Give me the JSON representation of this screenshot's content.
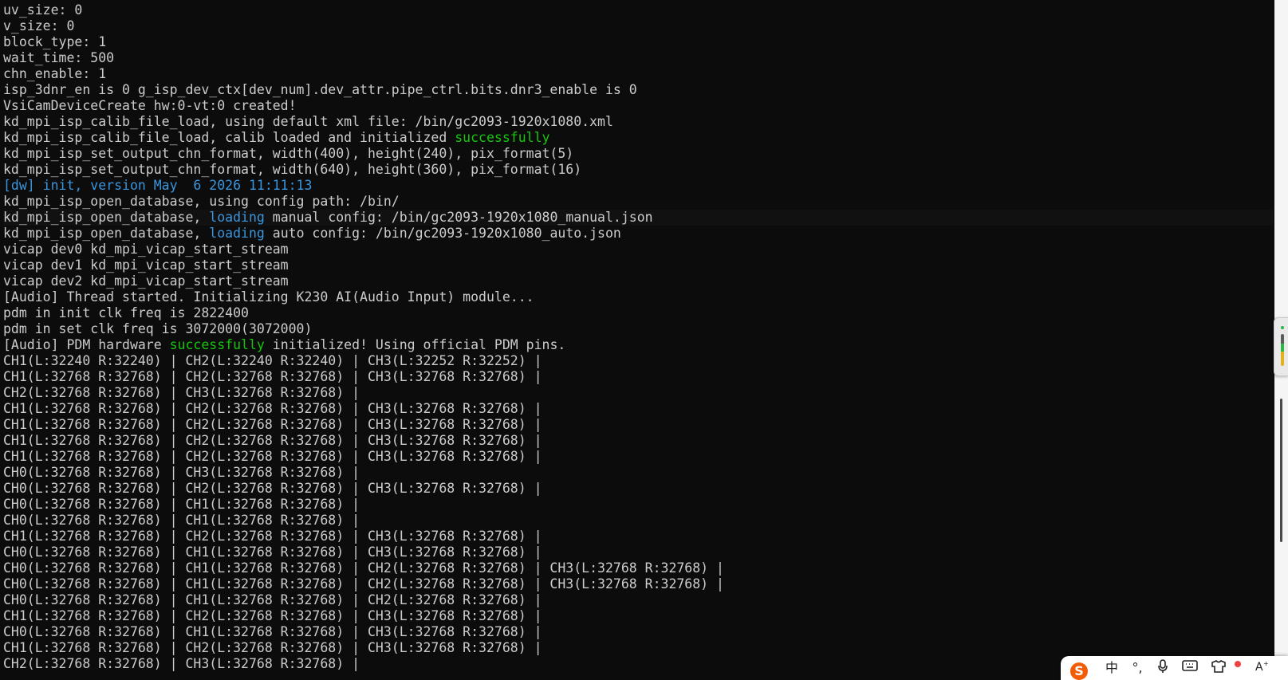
{
  "terminal": {
    "lines": [
      [
        {
          "t": "uv_size: 0"
        }
      ],
      [
        {
          "t": "v_size: 0"
        }
      ],
      [
        {
          "t": "block_type: 1"
        }
      ],
      [
        {
          "t": "wait_time: 500"
        }
      ],
      [
        {
          "t": "chn_enable: 1"
        }
      ],
      [
        {
          "t": "isp_3dnr_en is 0 g_isp_dev_ctx[dev_num].dev_attr.pipe_ctrl.bits.dnr3_enable is 0"
        }
      ],
      [
        {
          "t": "VsiCamDeviceCreate hw:0-vt:0 created!"
        }
      ],
      [
        {
          "t": "kd_mpi_isp_calib_file_load, using default xml file: /bin/gc2093-1920x1080.xml"
        }
      ],
      [
        {
          "t": "kd_mpi_isp_calib_file_load, calib loaded and initialized "
        },
        {
          "t": "successfully",
          "c": "green"
        }
      ],
      [
        {
          "t": "kd_mpi_isp_set_output_chn_format, width(400), height(240), pix_format(5)"
        }
      ],
      [
        {
          "t": "kd_mpi_isp_set_output_chn_format, width(640), height(360), pix_format(16)"
        }
      ],
      [
        {
          "t": "[dw] init, version May  6 2026 11:11:13",
          "c": "cyan"
        }
      ],
      [
        {
          "t": "kd_mpi_isp_open_database, using config path: /bin/"
        }
      ],
      [
        {
          "t": "kd_mpi_isp_open_database, "
        },
        {
          "t": "loading",
          "c": "cyan"
        },
        {
          "t": " manual config: /bin/gc2093-1920x1080_manual.json"
        }
      ],
      [
        {
          "t": "kd_mpi_isp_open_database, "
        },
        {
          "t": "loading",
          "c": "cyan"
        },
        {
          "t": " auto config: /bin/gc2093-1920x1080_auto.json"
        }
      ],
      [
        {
          "t": "vicap dev0 kd_mpi_vicap_start_stream"
        }
      ],
      [
        {
          "t": "vicap dev1 kd_mpi_vicap_start_stream"
        }
      ],
      [
        {
          "t": "vicap dev2 kd_mpi_vicap_start_stream"
        }
      ],
      [
        {
          "t": "[Audio] Thread started. Initializing K230 AI(Audio Input) module..."
        }
      ],
      [
        {
          "t": "pdm in init clk freq is 2822400"
        }
      ],
      [
        {
          "t": "pdm in set clk freq is 3072000(3072000)"
        }
      ],
      [
        {
          "t": "[Audio] PDM hardware "
        },
        {
          "t": "successfully",
          "c": "green"
        },
        {
          "t": " initialized! Using official PDM pins."
        }
      ],
      [
        {
          "t": "CH1(L:32240 R:32240) | CH2(L:32240 R:32240) | CH3(L:32252 R:32252) |"
        }
      ],
      [
        {
          "t": "CH1(L:32768 R:32768) | CH2(L:32768 R:32768) | CH3(L:32768 R:32768) |"
        }
      ],
      [
        {
          "t": "CH2(L:32768 R:32768) | CH3(L:32768 R:32768) |"
        }
      ],
      [
        {
          "t": "CH1(L:32768 R:32768) | CH2(L:32768 R:32768) | CH3(L:32768 R:32768) |"
        }
      ],
      [
        {
          "t": "CH1(L:32768 R:32768) | CH2(L:32768 R:32768) | CH3(L:32768 R:32768) |"
        }
      ],
      [
        {
          "t": "CH1(L:32768 R:32768) | CH2(L:32768 R:32768) | CH3(L:32768 R:32768) |"
        }
      ],
      [
        {
          "t": "CH1(L:32768 R:32768) | CH2(L:32768 R:32768) | CH3(L:32768 R:32768) |"
        }
      ],
      [
        {
          "t": "CH0(L:32768 R:32768) | CH3(L:32768 R:32768) |"
        }
      ],
      [
        {
          "t": "CH0(L:32768 R:32768) | CH2(L:32768 R:32768) | CH3(L:32768 R:32768) |"
        }
      ],
      [
        {
          "t": "CH0(L:32768 R:32768) | CH1(L:32768 R:32768) |"
        }
      ],
      [
        {
          "t": "CH0(L:32768 R:32768) | CH1(L:32768 R:32768) |"
        }
      ],
      [
        {
          "t": "CH1(L:32768 R:32768) | CH2(L:32768 R:32768) | CH3(L:32768 R:32768) |"
        }
      ],
      [
        {
          "t": "CH0(L:32768 R:32768) | CH1(L:32768 R:32768) | CH3(L:32768 R:32768) |"
        }
      ],
      [
        {
          "t": "CH0(L:32768 R:32768) | CH1(L:32768 R:32768) | CH2(L:32768 R:32768) | CH3(L:32768 R:32768) |"
        }
      ],
      [
        {
          "t": "CH0(L:32768 R:32768) | CH1(L:32768 R:32768) | CH2(L:32768 R:32768) | CH3(L:32768 R:32768) |"
        }
      ],
      [
        {
          "t": "CH0(L:32768 R:32768) | CH1(L:32768 R:32768) | CH2(L:32768 R:32768) |"
        }
      ],
      [
        {
          "t": "CH1(L:32768 R:32768) | CH2(L:32768 R:32768) | CH3(L:32768 R:32768) |"
        }
      ],
      [
        {
          "t": "CH0(L:32768 R:32768) | CH1(L:32768 R:32768) | CH3(L:32768 R:32768) |"
        }
      ],
      [
        {
          "t": "CH1(L:32768 R:32768) | CH2(L:32768 R:32768) | CH3(L:32768 R:32768) |"
        }
      ],
      [
        {
          "t": "CH2(L:32768 R:32768) | CH3(L:32768 R:32768) |"
        }
      ]
    ]
  },
  "colors": {
    "background": "#0c0c0c",
    "text": "#cccccc",
    "green": "#16c60c",
    "cyan": "#3a96dd"
  },
  "ime_toolbar": {
    "logo": "S",
    "lang": "中",
    "punct": "°,",
    "icons": [
      "sogou-logo-icon",
      "chinese-mode-icon",
      "punctuation-icon",
      "microphone-icon",
      "keyboard-icon",
      "skin-icon",
      "toolbox-icon"
    ]
  }
}
